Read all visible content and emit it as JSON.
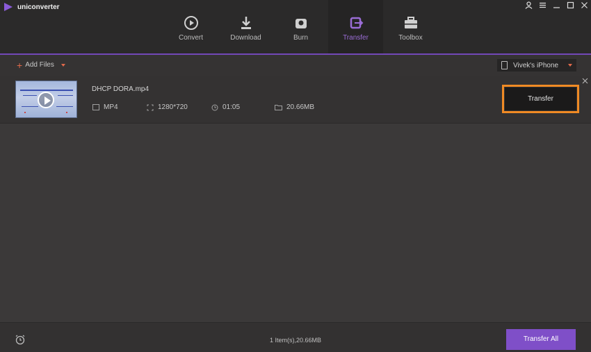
{
  "app": {
    "title": "uniconverter"
  },
  "nav": {
    "items": [
      {
        "label": "Convert",
        "icon": "play-circle-icon"
      },
      {
        "label": "Download",
        "icon": "download-icon"
      },
      {
        "label": "Burn",
        "icon": "disc-icon"
      },
      {
        "label": "Transfer",
        "icon": "transfer-icon"
      },
      {
        "label": "Toolbox",
        "icon": "toolbox-icon"
      }
    ],
    "active": "Transfer"
  },
  "toolbar": {
    "add_files_label": "Add Files",
    "device_label": "Vivek's iPhone"
  },
  "file": {
    "name": "DHCP DORA.mp4",
    "format": "MP4",
    "resolution": "1280*720",
    "duration": "01:05",
    "size": "20.66MB",
    "action_label": "Transfer"
  },
  "footer": {
    "status": "1 Item(s),20.66MB",
    "transfer_all_label": "Transfer All"
  },
  "colors": {
    "accent": "#7f4fc8",
    "highlight": "#f08a24",
    "nav_active_text": "#9b6dd6"
  }
}
